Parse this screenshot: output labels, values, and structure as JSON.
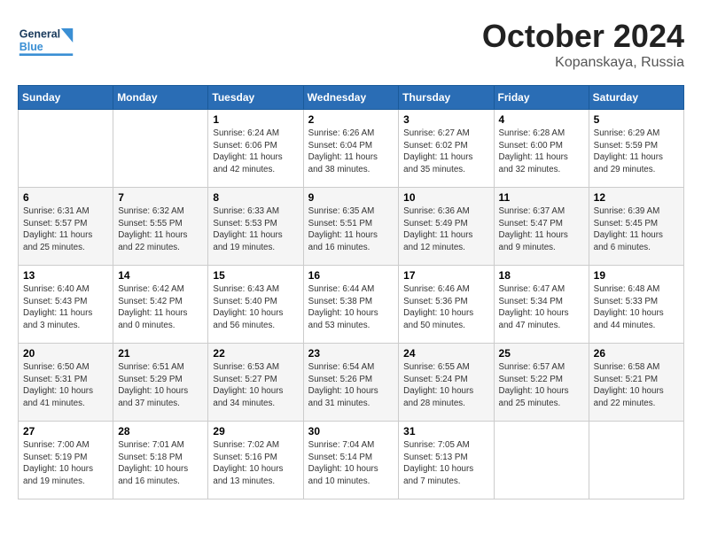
{
  "header": {
    "logo_general": "General",
    "logo_blue": "Blue",
    "month": "October 2024",
    "location": "Kopanskaya, Russia"
  },
  "days_of_week": [
    "Sunday",
    "Monday",
    "Tuesday",
    "Wednesday",
    "Thursday",
    "Friday",
    "Saturday"
  ],
  "weeks": [
    [
      {
        "day": "",
        "sunrise": "",
        "sunset": "",
        "daylight": ""
      },
      {
        "day": "",
        "sunrise": "",
        "sunset": "",
        "daylight": ""
      },
      {
        "day": "1",
        "sunrise": "Sunrise: 6:24 AM",
        "sunset": "Sunset: 6:06 PM",
        "daylight": "Daylight: 11 hours and 42 minutes."
      },
      {
        "day": "2",
        "sunrise": "Sunrise: 6:26 AM",
        "sunset": "Sunset: 6:04 PM",
        "daylight": "Daylight: 11 hours and 38 minutes."
      },
      {
        "day": "3",
        "sunrise": "Sunrise: 6:27 AM",
        "sunset": "Sunset: 6:02 PM",
        "daylight": "Daylight: 11 hours and 35 minutes."
      },
      {
        "day": "4",
        "sunrise": "Sunrise: 6:28 AM",
        "sunset": "Sunset: 6:00 PM",
        "daylight": "Daylight: 11 hours and 32 minutes."
      },
      {
        "day": "5",
        "sunrise": "Sunrise: 6:29 AM",
        "sunset": "Sunset: 5:59 PM",
        "daylight": "Daylight: 11 hours and 29 minutes."
      }
    ],
    [
      {
        "day": "6",
        "sunrise": "Sunrise: 6:31 AM",
        "sunset": "Sunset: 5:57 PM",
        "daylight": "Daylight: 11 hours and 25 minutes."
      },
      {
        "day": "7",
        "sunrise": "Sunrise: 6:32 AM",
        "sunset": "Sunset: 5:55 PM",
        "daylight": "Daylight: 11 hours and 22 minutes."
      },
      {
        "day": "8",
        "sunrise": "Sunrise: 6:33 AM",
        "sunset": "Sunset: 5:53 PM",
        "daylight": "Daylight: 11 hours and 19 minutes."
      },
      {
        "day": "9",
        "sunrise": "Sunrise: 6:35 AM",
        "sunset": "Sunset: 5:51 PM",
        "daylight": "Daylight: 11 hours and 16 minutes."
      },
      {
        "day": "10",
        "sunrise": "Sunrise: 6:36 AM",
        "sunset": "Sunset: 5:49 PM",
        "daylight": "Daylight: 11 hours and 12 minutes."
      },
      {
        "day": "11",
        "sunrise": "Sunrise: 6:37 AM",
        "sunset": "Sunset: 5:47 PM",
        "daylight": "Daylight: 11 hours and 9 minutes."
      },
      {
        "day": "12",
        "sunrise": "Sunrise: 6:39 AM",
        "sunset": "Sunset: 5:45 PM",
        "daylight": "Daylight: 11 hours and 6 minutes."
      }
    ],
    [
      {
        "day": "13",
        "sunrise": "Sunrise: 6:40 AM",
        "sunset": "Sunset: 5:43 PM",
        "daylight": "Daylight: 11 hours and 3 minutes."
      },
      {
        "day": "14",
        "sunrise": "Sunrise: 6:42 AM",
        "sunset": "Sunset: 5:42 PM",
        "daylight": "Daylight: 11 hours and 0 minutes."
      },
      {
        "day": "15",
        "sunrise": "Sunrise: 6:43 AM",
        "sunset": "Sunset: 5:40 PM",
        "daylight": "Daylight: 10 hours and 56 minutes."
      },
      {
        "day": "16",
        "sunrise": "Sunrise: 6:44 AM",
        "sunset": "Sunset: 5:38 PM",
        "daylight": "Daylight: 10 hours and 53 minutes."
      },
      {
        "day": "17",
        "sunrise": "Sunrise: 6:46 AM",
        "sunset": "Sunset: 5:36 PM",
        "daylight": "Daylight: 10 hours and 50 minutes."
      },
      {
        "day": "18",
        "sunrise": "Sunrise: 6:47 AM",
        "sunset": "Sunset: 5:34 PM",
        "daylight": "Daylight: 10 hours and 47 minutes."
      },
      {
        "day": "19",
        "sunrise": "Sunrise: 6:48 AM",
        "sunset": "Sunset: 5:33 PM",
        "daylight": "Daylight: 10 hours and 44 minutes."
      }
    ],
    [
      {
        "day": "20",
        "sunrise": "Sunrise: 6:50 AM",
        "sunset": "Sunset: 5:31 PM",
        "daylight": "Daylight: 10 hours and 41 minutes."
      },
      {
        "day": "21",
        "sunrise": "Sunrise: 6:51 AM",
        "sunset": "Sunset: 5:29 PM",
        "daylight": "Daylight: 10 hours and 37 minutes."
      },
      {
        "day": "22",
        "sunrise": "Sunrise: 6:53 AM",
        "sunset": "Sunset: 5:27 PM",
        "daylight": "Daylight: 10 hours and 34 minutes."
      },
      {
        "day": "23",
        "sunrise": "Sunrise: 6:54 AM",
        "sunset": "Sunset: 5:26 PM",
        "daylight": "Daylight: 10 hours and 31 minutes."
      },
      {
        "day": "24",
        "sunrise": "Sunrise: 6:55 AM",
        "sunset": "Sunset: 5:24 PM",
        "daylight": "Daylight: 10 hours and 28 minutes."
      },
      {
        "day": "25",
        "sunrise": "Sunrise: 6:57 AM",
        "sunset": "Sunset: 5:22 PM",
        "daylight": "Daylight: 10 hours and 25 minutes."
      },
      {
        "day": "26",
        "sunrise": "Sunrise: 6:58 AM",
        "sunset": "Sunset: 5:21 PM",
        "daylight": "Daylight: 10 hours and 22 minutes."
      }
    ],
    [
      {
        "day": "27",
        "sunrise": "Sunrise: 7:00 AM",
        "sunset": "Sunset: 5:19 PM",
        "daylight": "Daylight: 10 hours and 19 minutes."
      },
      {
        "day": "28",
        "sunrise": "Sunrise: 7:01 AM",
        "sunset": "Sunset: 5:18 PM",
        "daylight": "Daylight: 10 hours and 16 minutes."
      },
      {
        "day": "29",
        "sunrise": "Sunrise: 7:02 AM",
        "sunset": "Sunset: 5:16 PM",
        "daylight": "Daylight: 10 hours and 13 minutes."
      },
      {
        "day": "30",
        "sunrise": "Sunrise: 7:04 AM",
        "sunset": "Sunset: 5:14 PM",
        "daylight": "Daylight: 10 hours and 10 minutes."
      },
      {
        "day": "31",
        "sunrise": "Sunrise: 7:05 AM",
        "sunset": "Sunset: 5:13 PM",
        "daylight": "Daylight: 10 hours and 7 minutes."
      },
      {
        "day": "",
        "sunrise": "",
        "sunset": "",
        "daylight": ""
      },
      {
        "day": "",
        "sunrise": "",
        "sunset": "",
        "daylight": ""
      }
    ]
  ]
}
